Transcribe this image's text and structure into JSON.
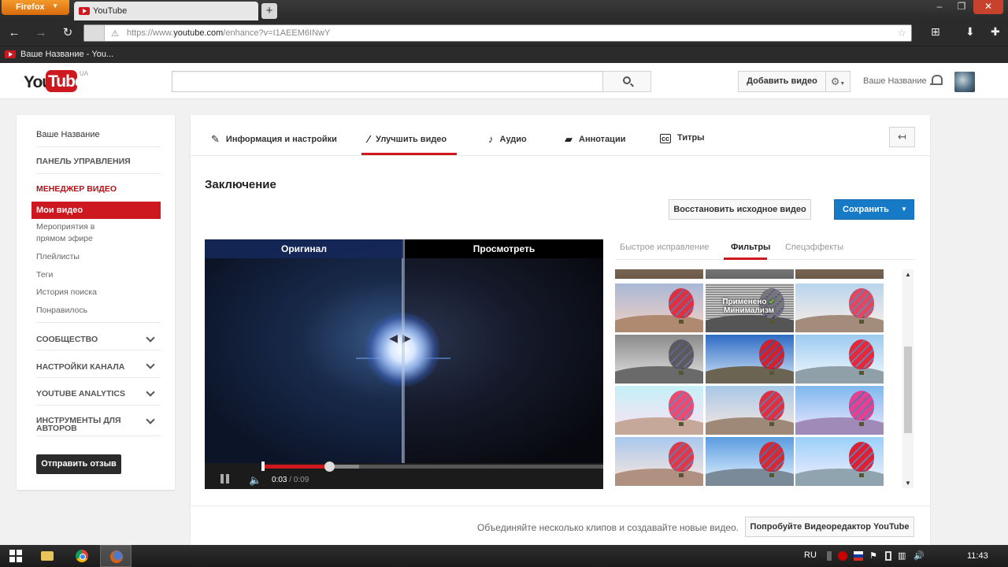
{
  "browser": {
    "menu_label": "Firefox",
    "tab_title": "YouTube",
    "url_prefix": "https://www.",
    "url_domain": "youtube.com",
    "url_path": "/enhance?v=I1AEEM6INwY",
    "bookmark": "Ваше Название - You..."
  },
  "masthead": {
    "logo_you": "You",
    "logo_tube": "Tube",
    "logo_region": "UA",
    "upload_label": "Добавить видео",
    "user_name": "Ваше Название"
  },
  "guide": {
    "channel_name": "Ваше Название",
    "dashboard": "ПАНЕЛЬ УПРАВЛЕНИЯ",
    "video_manager": "МЕНЕДЖЕР ВИДЕО",
    "my_videos": "Мои видео",
    "live_events": "Мероприятия в прямом эфире",
    "playlists": "Плейлисты",
    "tags": "Теги",
    "search_history": "История поиска",
    "liked": "Понравилось",
    "community": "СООБЩЕСТВО",
    "channel_settings": "НАСТРОЙКИ КАНАЛА",
    "analytics": "YOUTUBE ANALYTICS",
    "creator_tools": "ИНСТРУМЕНТЫ ДЛЯ АВТОРОВ",
    "feedback": "Отправить отзыв"
  },
  "editor": {
    "tabs": [
      {
        "label": "Информация и настройки",
        "icon": "pencil-icon"
      },
      {
        "label": "Улучшить видео",
        "icon": "magic-wand-icon"
      },
      {
        "label": "Аудио",
        "icon": "music-note-icon"
      },
      {
        "label": "Аннотации",
        "icon": "speech-bubble-icon"
      },
      {
        "label": "Титры",
        "icon": "cc-icon"
      }
    ],
    "section_title": "Заключение",
    "revert_label": "Восстановить исходное видео",
    "save_label": "Сохранить",
    "player": {
      "original_label": "Оригинал",
      "preview_label": "Просмотреть",
      "current_time": "0:03",
      "duration": "/ 0:09",
      "progress_fraction": 0.33
    },
    "filter_tabs": [
      "Быстрое исправление",
      "Фильтры",
      "Спецэффекты"
    ],
    "applied_label": "Применено",
    "filter_name": "Минимализм",
    "promo_text": "Объединяйте несколько клипов и создавайте новые видео.",
    "promo_button": "Попробуйте Видеоредактор YouTube"
  },
  "taskbar": {
    "lang": "RU",
    "clock": "11:43"
  },
  "colors": {
    "brand_red": "#cc181e",
    "save_blue": "#167ac6"
  }
}
